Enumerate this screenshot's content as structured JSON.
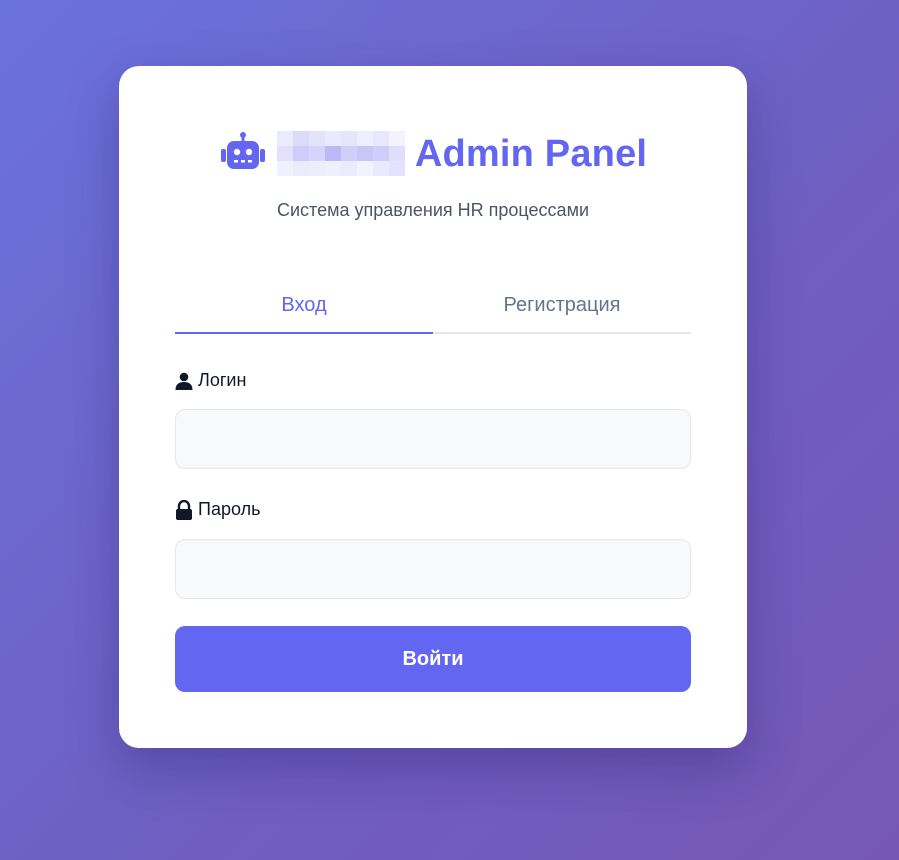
{
  "brand": {
    "icon": "robot-icon",
    "redacted_text": "",
    "title": "Admin Panel",
    "subtitle": "Система управления HR процессами"
  },
  "tabs": [
    {
      "label": "Вход",
      "active": true
    },
    {
      "label": "Регистрация",
      "active": false
    }
  ],
  "form": {
    "login": {
      "label": "Логин",
      "icon": "user-icon",
      "value": "",
      "placeholder": ""
    },
    "password": {
      "label": "Пароль",
      "icon": "lock-icon",
      "value": "",
      "placeholder": ""
    },
    "submit_label": "Войти"
  },
  "colors": {
    "accent": "#6366f1",
    "background_start": "#6a72dc",
    "background_end": "#7657b6"
  }
}
